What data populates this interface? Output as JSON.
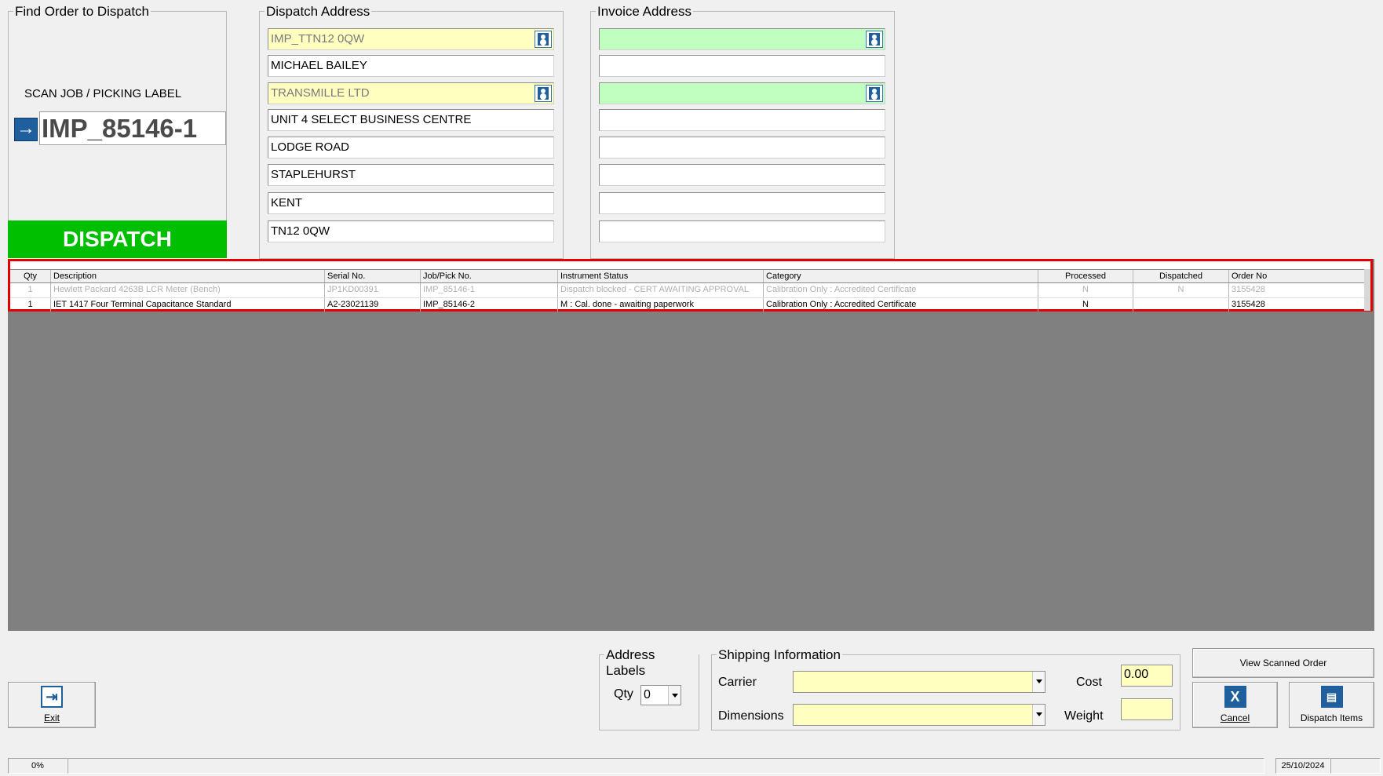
{
  "find_order": {
    "title": "Find Order to Dispatch",
    "scan_label": "SCAN JOB / PICKING LABEL",
    "scan_value": "IMP_85146-1",
    "dispatch_button": "DISPATCH"
  },
  "dispatch_address": {
    "title": "Dispatch Address",
    "lines": [
      "IMP_TTN12 0QW",
      "MICHAEL BAILEY",
      "TRANSMILLE LTD",
      "UNIT 4 SELECT BUSINESS CENTRE",
      "LODGE ROAD",
      "STAPLEHURST",
      "KENT",
      "TN12 0QW"
    ]
  },
  "invoice_address": {
    "title": "Invoice Address",
    "lines": [
      "",
      "",
      "",
      "",
      "",
      "",
      "",
      ""
    ]
  },
  "grid": {
    "columns": [
      "Qty",
      "Description",
      "Serial No.",
      "Job/Pick No.",
      "Instrument Status",
      "Category",
      "Processed",
      "Dispatched",
      "Order No"
    ],
    "rows": [
      {
        "qty": "1",
        "description": "Hewlett Packard 4263B LCR Meter (Bench)",
        "serial": "JP1KD00391",
        "job": "IMP_85146-1",
        "status": "Dispatch blocked - CERT AWAITING APPROVAL",
        "category": "Calibration Only : Accredited Certificate",
        "processed": "N",
        "dispatched": "N",
        "order": "3155428"
      },
      {
        "qty": "1",
        "description": "IET 1417 Four Terminal Capacitance Standard",
        "serial": "A2-23021139",
        "job": "IMP_85146-2",
        "status": "M : Cal. done - awaiting paperwork",
        "category": "Calibration Only : Accredited Certificate",
        "processed": "N",
        "dispatched": "",
        "order": "3155428"
      }
    ]
  },
  "address_labels": {
    "title": "Address Labels",
    "qty_label": "Qty",
    "qty_value": "0"
  },
  "shipping": {
    "title": "Shipping Information",
    "carrier_label": "Carrier",
    "carrier_value": "",
    "dimensions_label": "Dimensions",
    "dimensions_value": "",
    "cost_label": "Cost",
    "cost_value": "0.00",
    "weight_label": "Weight",
    "weight_value": ""
  },
  "buttons": {
    "exit": "Exit",
    "view_scanned_order": "View Scanned Order",
    "cancel": "Cancel",
    "dispatch_items": "Dispatch Items"
  },
  "status_bar": {
    "progress": "0%",
    "date": "25/10/2024"
  },
  "colors": {
    "dispatch_green": "#00bf00",
    "required_yellow": "#ffffc0",
    "invoice_green": "#c0ffc0",
    "grid_highlight": "#e00000",
    "grid_background": "#808080"
  },
  "icons": {
    "scan": "arrow-right-icon",
    "contact": "contact-card-icon",
    "exit": "exit-door-icon",
    "cancel": "cancel-x-icon",
    "dispatch": "dispatch-icon"
  }
}
